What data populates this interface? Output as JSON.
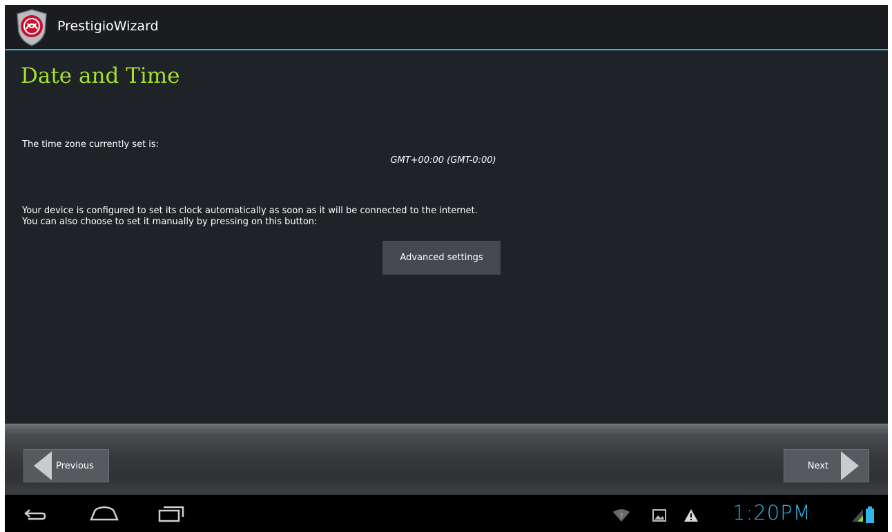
{
  "app": {
    "title": "PrestigioWizard",
    "accent_color": "#33b5e5",
    "logo_icon": "prestigio-shield-logo-icon"
  },
  "page": {
    "title": "Date and Time",
    "title_color": "#a4e12b",
    "timezone_label": "The time zone currently set is:",
    "timezone_value": "GMT+00:00 (GMT-0:00)",
    "description_line1": "Your device is configured to set its clock automatically as soon as it will be connected to the internet.",
    "description_line2": "You can also choose to set it manually by pressing on this button:",
    "advanced_button_label": "Advanced settings"
  },
  "footer": {
    "previous_label": "Previous",
    "next_label": "Next"
  },
  "system_bar": {
    "nav_icons": [
      "back-icon",
      "home-icon",
      "recent-apps-icon"
    ],
    "status_icons": [
      "wifi-icon",
      "gallery-notification-icon",
      "warning-icon",
      "signal-icon",
      "battery-icon"
    ],
    "clock": "1:20PM"
  }
}
